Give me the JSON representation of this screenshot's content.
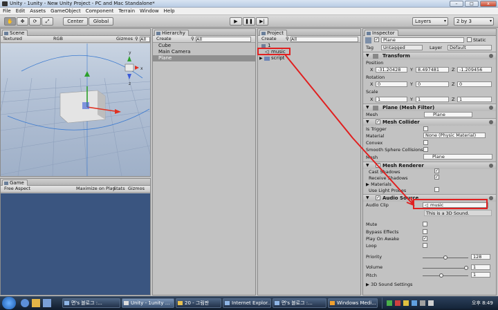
{
  "window": {
    "title": "Unity - 1unity - New Unity Project - PC and Mac Standalone*",
    "min_glyph": "–",
    "max_glyph": "□",
    "close_glyph": "x"
  },
  "menu": [
    "File",
    "Edit",
    "Assets",
    "GameObject",
    "Component",
    "Terrain",
    "Window",
    "Help"
  ],
  "toolbar": {
    "tool_glyphs": [
      "✋",
      "✥",
      "⟳",
      "⤢"
    ],
    "pivot": "Center",
    "space": "Global",
    "play": "▶",
    "pause": "❚❚",
    "step": "▶|",
    "layers": "Layers",
    "layout": "2 by 3"
  },
  "scene": {
    "tab": "Scene",
    "draw_mode": "Textured",
    "render_mode": "RGB",
    "gizmos": "Gizmos",
    "search_glyph": "⚲",
    "search_value": "All",
    "gizmo_axes": [
      "y",
      "x",
      "z"
    ]
  },
  "game": {
    "tab": "Game",
    "aspect": "Free Aspect",
    "maximize": "Maximize on Play",
    "stats": "Stats",
    "gizmos": "Gizmos"
  },
  "hierarchy": {
    "tab": "Hierarchy",
    "create": "Create",
    "search_glyph": "⚲",
    "search_value": "All",
    "items": [
      "Cube",
      "Main Camera",
      "Plane"
    ]
  },
  "project": {
    "tab": "Project",
    "create": "Create",
    "search_glyph": "⚲",
    "search_value": "All",
    "items": [
      "1",
      "music",
      "script"
    ]
  },
  "inspector": {
    "tab": "Inspector",
    "object_name": "Plane",
    "static": "Static",
    "tag_label": "Tag",
    "tag_value": "Untagged",
    "layer_label": "Layer",
    "layer_value": "Default",
    "transform": {
      "title": "Transform",
      "position_label": "Position",
      "position": [
        "-31.20428",
        "8.497481",
        "-1.209456"
      ],
      "rotation_label": "Rotation",
      "rotation": [
        "0",
        "0",
        "0"
      ],
      "scale_label": "Scale",
      "scale": [
        "1",
        "1",
        "1"
      ],
      "axis_labels": [
        "X",
        "Y",
        "Z"
      ]
    },
    "mesh_filter": {
      "title": "Plane (Mesh Filter)",
      "mesh_label": "Mesh",
      "mesh_value": "Plane"
    },
    "mesh_collider": {
      "title": "Mesh Collider",
      "is_trigger_label": "Is Trigger",
      "is_trigger": false,
      "material_label": "Material",
      "material_value": "None (Physic Material)",
      "convex_label": "Convex",
      "convex": false,
      "smooth_label": "Smooth Sphere Collisions",
      "smooth": false,
      "mesh_label": "Mesh",
      "mesh_value": "Plane"
    },
    "mesh_renderer": {
      "title": "Mesh Renderer",
      "cast_shadows_label": "Cast Shadows",
      "cast_shadows": true,
      "receive_shadows_label": "Receive Shadows",
      "receive_shadows": true,
      "materials_label": "Materials",
      "light_probes_label": "Use Light Probes",
      "light_probes": false
    },
    "audio_source": {
      "title": "Audio Source",
      "clip_label": "Audio Clip",
      "clip_value": "music",
      "note": "This is a 3D Sound.",
      "mute_label": "Mute",
      "mute": false,
      "bypass_label": "Bypass Effects",
      "bypass": false,
      "play_on_awake_label": "Play On Awake",
      "play_on_awake": true,
      "loop_label": "Loop",
      "loop": false,
      "priority_label": "Priority",
      "priority": "128",
      "priority_fraction": 0.5,
      "volume_label": "Volume",
      "volume": "1",
      "volume_fraction": 1.0,
      "pitch_label": "Pitch",
      "pitch": "1",
      "pitch_fraction": 0.4,
      "sound3d_label": "3D Sound Settings"
    }
  },
  "taskbar": {
    "tasks": [
      "면's 블로그 :...",
      "Unity - 1unity ...",
      "20 - 그림판",
      "Internet Explor...",
      "면's 블로그 :...",
      "Windows Medi..."
    ],
    "active_index": 1,
    "time": "오후 8:49"
  },
  "colors": {
    "annotation": "#e02020",
    "selected_row": "#8f8f8f",
    "game_view": "#3a5580",
    "sky": "#9fb4d0"
  }
}
